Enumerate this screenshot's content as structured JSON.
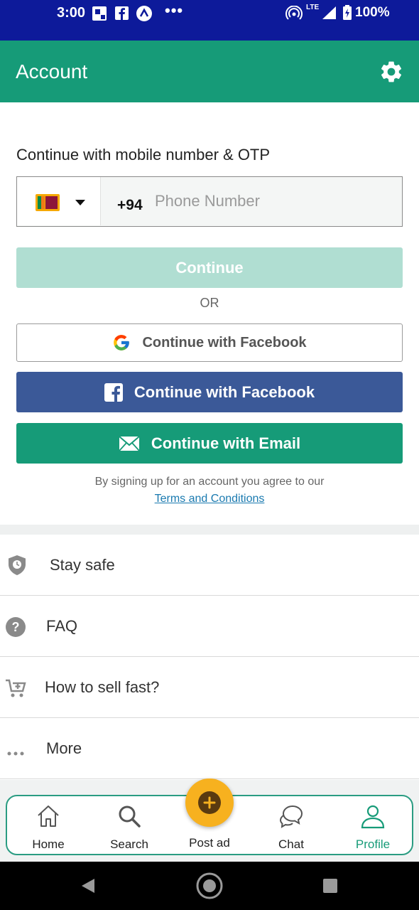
{
  "status_bar": {
    "time": "3:00",
    "dots": "•••",
    "network": "LTE",
    "battery": "100%"
  },
  "app_bar": {
    "title": "Account",
    "settings_icon": "gear-icon"
  },
  "login": {
    "heading": "Continue with mobile number & OTP",
    "country_code": "+94",
    "phone_placeholder": "Phone Number",
    "phone_value": "",
    "continue_label": "Continue",
    "or_label": "OR",
    "google_label": "Continue with Facebook",
    "facebook_label": "Continue with Facebook",
    "email_label": "Continue with Email",
    "terms_text": "By signing up for an account you agree to our",
    "terms_link": "Terms and Conditions"
  },
  "menu": {
    "items": [
      {
        "label": "Stay safe",
        "icon": "shield-clock-icon"
      },
      {
        "label": "FAQ",
        "icon": "question-circle-icon"
      },
      {
        "label": "How to sell fast?",
        "icon": "cart-plus-icon"
      },
      {
        "label": "More",
        "icon": "more-dots-icon"
      }
    ]
  },
  "bottom_nav": {
    "items": [
      {
        "label": "Home",
        "icon": "home-icon"
      },
      {
        "label": "Search",
        "icon": "search-icon"
      },
      {
        "label": "Post ad",
        "icon": "plus-circle-icon"
      },
      {
        "label": "Chat",
        "icon": "chat-bubbles-icon"
      },
      {
        "label": "Profile",
        "icon": "person-icon"
      }
    ],
    "active": "Profile"
  },
  "colors": {
    "status_bar": "#0d1a9a",
    "accent": "#169b78",
    "continue_disabled": "#b0ded2",
    "facebook": "#3b5998",
    "post_ad": "#f7b11f"
  }
}
